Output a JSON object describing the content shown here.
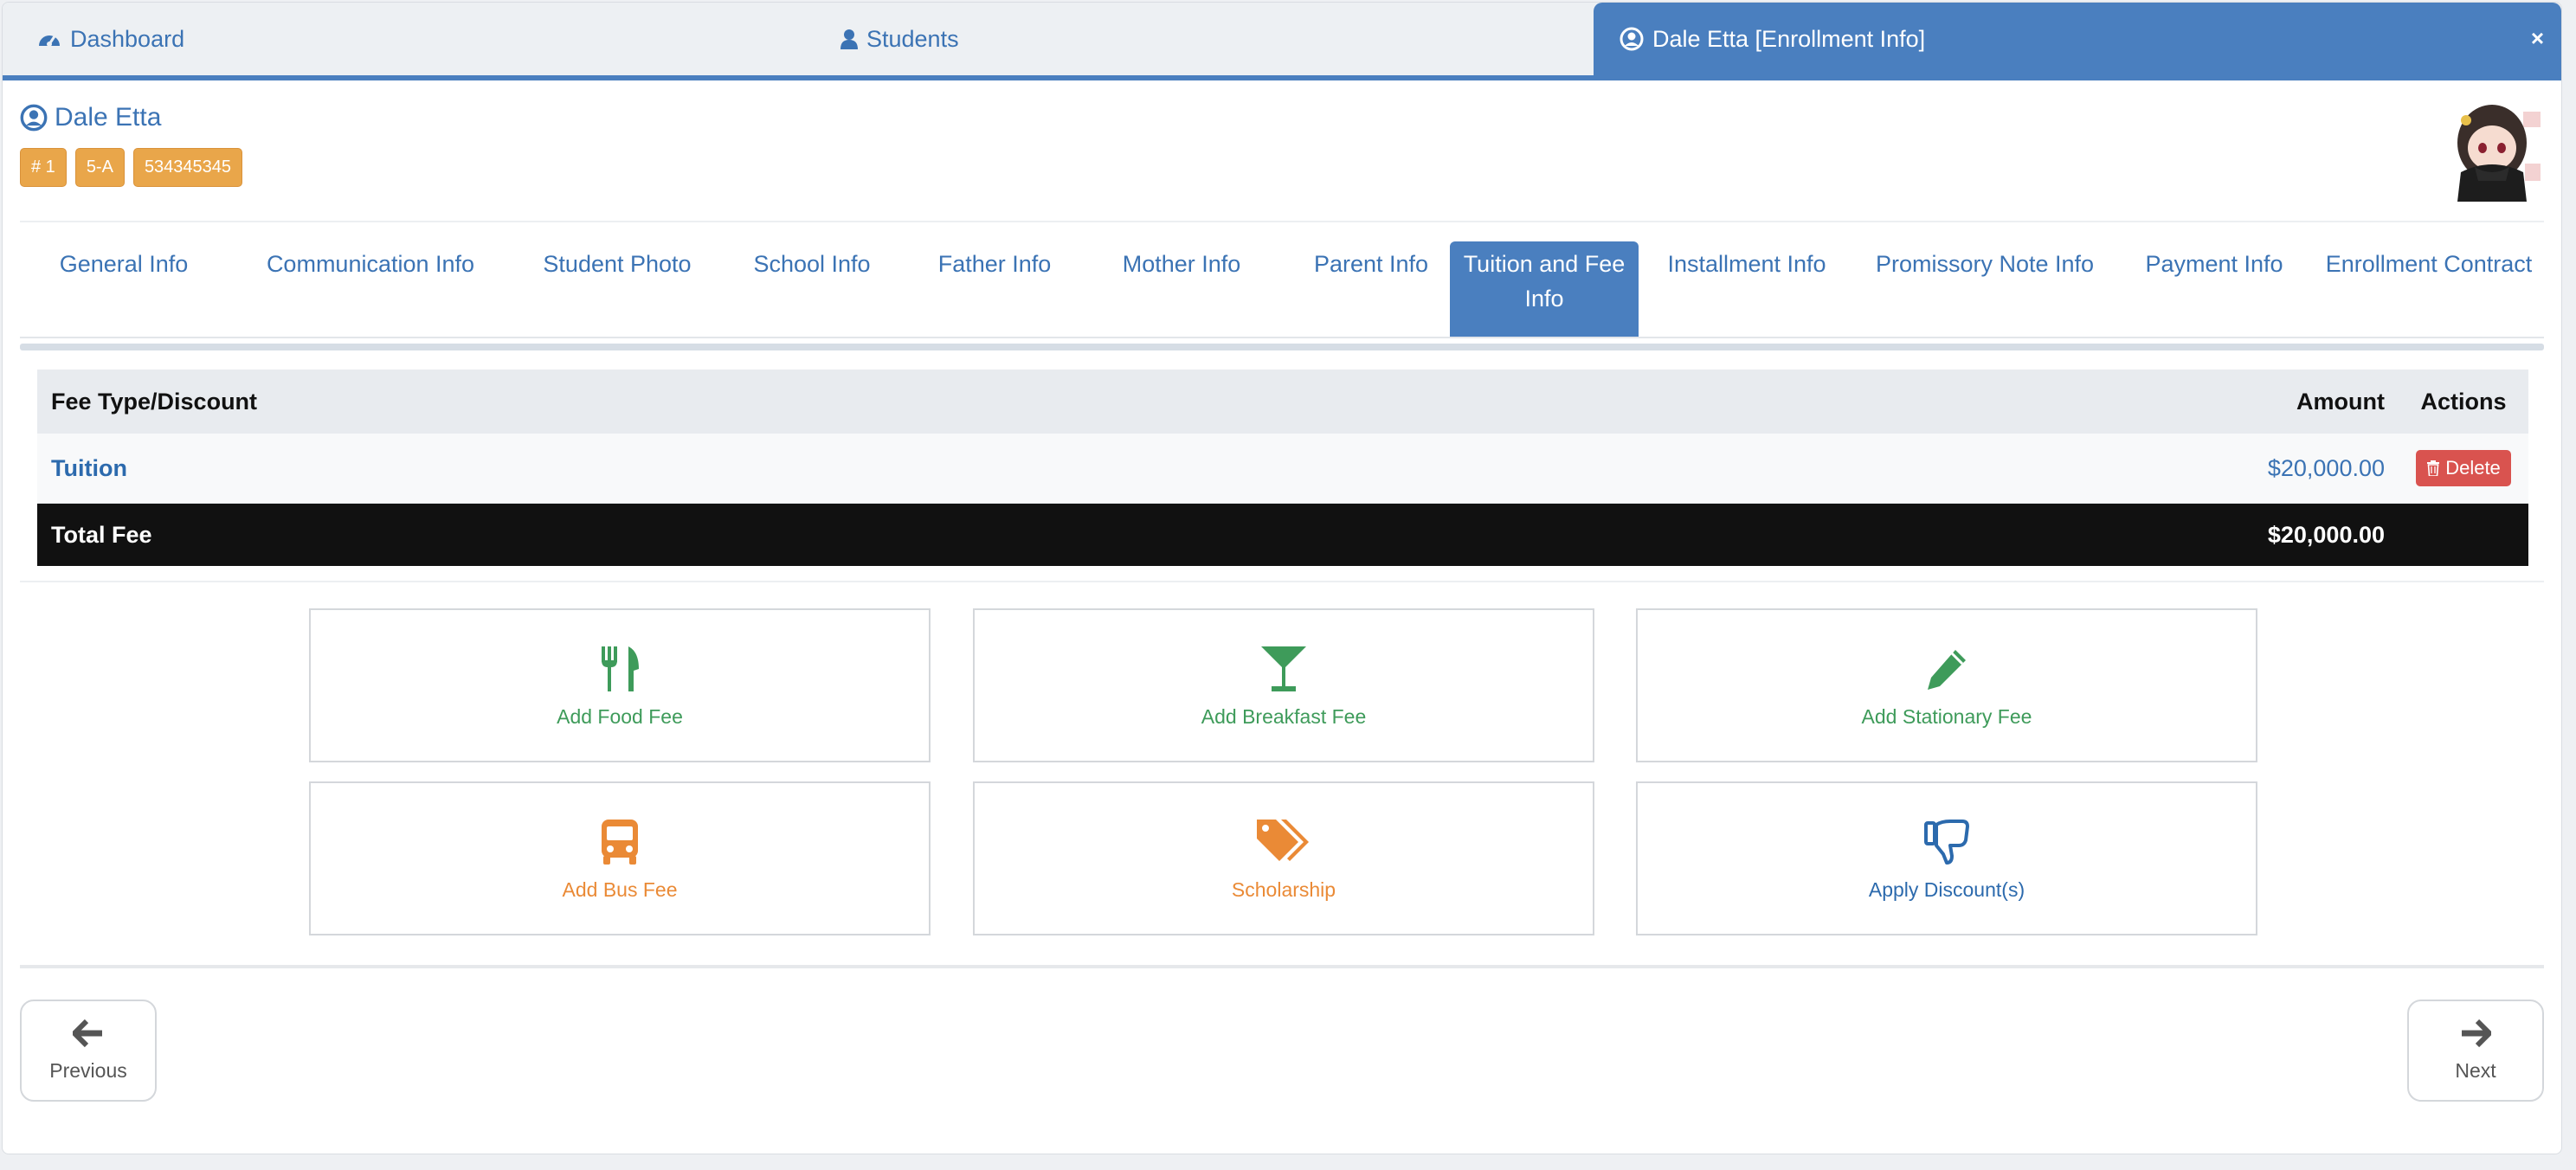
{
  "top_tabs": {
    "dashboard": "Dashboard",
    "students": "Students",
    "enrollment": "Dale Etta [Enrollment Info]",
    "close": "×"
  },
  "student": {
    "name": "Dale Etta",
    "badges": [
      "# 1",
      "5-A",
      "534345345"
    ]
  },
  "section_tabs": [
    {
      "line1": "General Info",
      "line2": ""
    },
    {
      "line1": "Communication Info",
      "line2": ""
    },
    {
      "line1": "Student Photo",
      "line2": ""
    },
    {
      "line1": "School Info",
      "line2": ""
    },
    {
      "line1": "Father Info",
      "line2": ""
    },
    {
      "line1": "Mother Info",
      "line2": ""
    },
    {
      "line1": "Parent Info",
      "line2": ""
    },
    {
      "line1": "Tuition and Fee",
      "line2": "Info"
    },
    {
      "line1": "Installment Info",
      "line2": ""
    },
    {
      "line1": "Promissory Note Info",
      "line2": ""
    },
    {
      "line1": "Payment Info",
      "line2": ""
    },
    {
      "line1": "Enrollment Contract",
      "line2": ""
    }
  ],
  "table": {
    "headers": {
      "type": "Fee Type/Discount",
      "amount": "Amount",
      "actions": "Actions"
    },
    "rows": [
      {
        "type": "Tuition",
        "amount": "$20,000.00",
        "action": "Delete"
      }
    ],
    "total": {
      "label": "Total Fee",
      "amount": "$20,000.00"
    }
  },
  "actions": [
    {
      "label": "Add Food Fee",
      "icon": "cutlery-icon",
      "color": "#3e9b5a"
    },
    {
      "label": "Add Breakfast Fee",
      "icon": "cocktail-glass-icon",
      "color": "#3e9b5a"
    },
    {
      "label": "Add Stationary Fee",
      "icon": "pencil-icon",
      "color": "#3e9b5a"
    },
    {
      "label": "Add Bus Fee",
      "icon": "bus-icon",
      "color": "#ea8a36"
    },
    {
      "label": "Scholarship",
      "icon": "tags-icon",
      "color": "#ea8a36"
    },
    {
      "label": "Apply Discount(s)",
      "icon": "thumbs-down-icon",
      "color": "#2c6aad"
    }
  ],
  "nav": {
    "previous": "Previous",
    "next": "Next"
  },
  "colors": {
    "primary": "#4a7fbf",
    "badge": "#e9a64a",
    "danger": "#d9534f",
    "success": "#3e9b5a",
    "warning": "#ea8a36"
  }
}
